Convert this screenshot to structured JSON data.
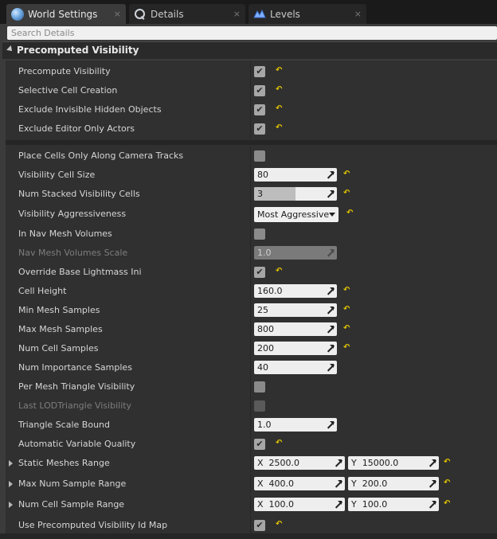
{
  "tabs": [
    {
      "label": "World Settings",
      "icon": "globe-icon",
      "close": "×"
    },
    {
      "label": "Details",
      "icon": "magnifier-icon",
      "close": "×"
    },
    {
      "label": "Levels",
      "icon": "levels-icon",
      "close": "×"
    }
  ],
  "search": {
    "placeholder": "Search Details"
  },
  "category": {
    "title": "Precomputed Visibility"
  },
  "glyphs": {
    "check": "✔",
    "reset": "↶"
  },
  "group1": [
    {
      "name": "Precompute Visibility",
      "checked": true
    },
    {
      "name": "Selective Cell Creation",
      "checked": true
    },
    {
      "name": "Exclude Invisible Hidden Objects",
      "checked": true
    },
    {
      "name": "Exclude Editor Only Actors",
      "checked": true
    }
  ],
  "group2": [
    {
      "name": "Place Cells Only Along Camera Tracks",
      "type": "checkbox",
      "checked": false
    },
    {
      "name": "Visibility Cell Size",
      "type": "number",
      "value": "80"
    },
    {
      "name": "Num Stacked Visibility Cells",
      "type": "slider",
      "value": "3",
      "fill": 0.5
    },
    {
      "name": "Visibility Aggressiveness",
      "type": "dropdown",
      "value": "Most Aggressive"
    },
    {
      "name": "In Nav Mesh Volumes",
      "type": "checkbox",
      "checked": false
    },
    {
      "name": "Nav Mesh Volumes Scale",
      "type": "number",
      "value": "1.0",
      "disabled": true
    },
    {
      "name": "Override Base Lightmass Ini",
      "type": "checkbox",
      "checked": true
    },
    {
      "name": "Cell Height",
      "type": "number",
      "value": "160.0"
    },
    {
      "name": "Min Mesh Samples",
      "type": "number",
      "value": "25"
    },
    {
      "name": "Max Mesh Samples",
      "type": "number",
      "value": "800"
    },
    {
      "name": "Num Cell Samples",
      "type": "number",
      "value": "200"
    },
    {
      "name": "Num Importance Samples",
      "type": "number",
      "value": "40"
    },
    {
      "name": "Per Mesh Triangle Visibility",
      "type": "checkbox",
      "checked": false
    },
    {
      "name": "Last LODTriangle Visibility",
      "type": "checkbox",
      "checked": false,
      "disabled": true
    },
    {
      "name": "Triangle Scale Bound",
      "type": "number",
      "value": "1.0"
    },
    {
      "name": "Automatic Variable Quality",
      "type": "checkbox",
      "checked": true
    },
    {
      "name": "Static Meshes Range",
      "type": "vector",
      "x": "2500.0",
      "y": "15000.0"
    },
    {
      "name": "Max Num Sample Range",
      "type": "vector",
      "x": "400.0",
      "y": "200.0"
    },
    {
      "name": "Num Cell Sample Range",
      "type": "vector",
      "x": "100.0",
      "y": "100.0"
    },
    {
      "name": "Use Precomputed Visibility Id Map",
      "type": "checkbox",
      "checked": true
    }
  ],
  "vector_axes": {
    "x": "X",
    "y": "Y"
  },
  "colors": {
    "accent_reset": "#e3c400",
    "panel": "#3b3b3b",
    "field": "#eeeeee"
  }
}
